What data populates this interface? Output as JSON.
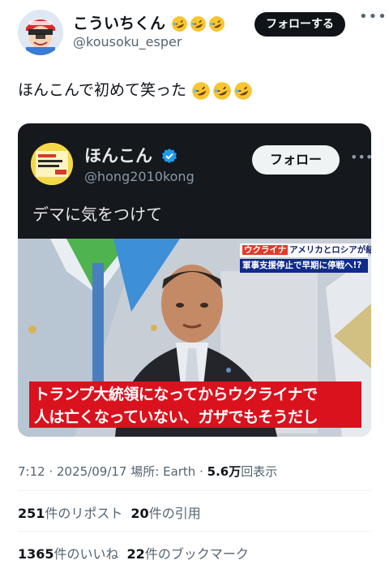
{
  "post": {
    "display_name": "こういちくん",
    "handle": "@kousoku_esper",
    "follow_label": "フォローする",
    "more_icon": "more-horizontal-icon",
    "text": "ほんこんで初めて笑った"
  },
  "quoted": {
    "display_name": "ほんこん",
    "handle": "@hong2010kong",
    "follow_label": "フォロー",
    "text": "デマに気をつけて",
    "video": {
      "banner_tag": "ウクライナ",
      "banner_line1": "アメリカとロシアが結託!?",
      "banner_line2": "軍事支援停止で早期に停戦へ!?",
      "caption_line1": "トランプ大統領になってからウクライナで",
      "caption_line2": "人は亡くなっていない、ガザでもそうだし"
    }
  },
  "meta": {
    "time": "7:12",
    "date": "2025/09/17",
    "location": "場所: Earth",
    "views_value": "5.6万",
    "views_label": "回表示"
  },
  "stats": {
    "reposts_count": "251",
    "reposts_label": "件のリポスト",
    "quotes_count": "20",
    "quotes_label": "件の引用",
    "likes_count": "1365",
    "likes_label": "件のいいね",
    "bookmarks_count": "22",
    "bookmarks_label": "件のブックマーク"
  },
  "colors": {
    "accent": "#1d9bf0",
    "text": "#0f1419",
    "muted": "#536471",
    "card_bg": "#15181c",
    "caption_red": "#d9121e"
  }
}
